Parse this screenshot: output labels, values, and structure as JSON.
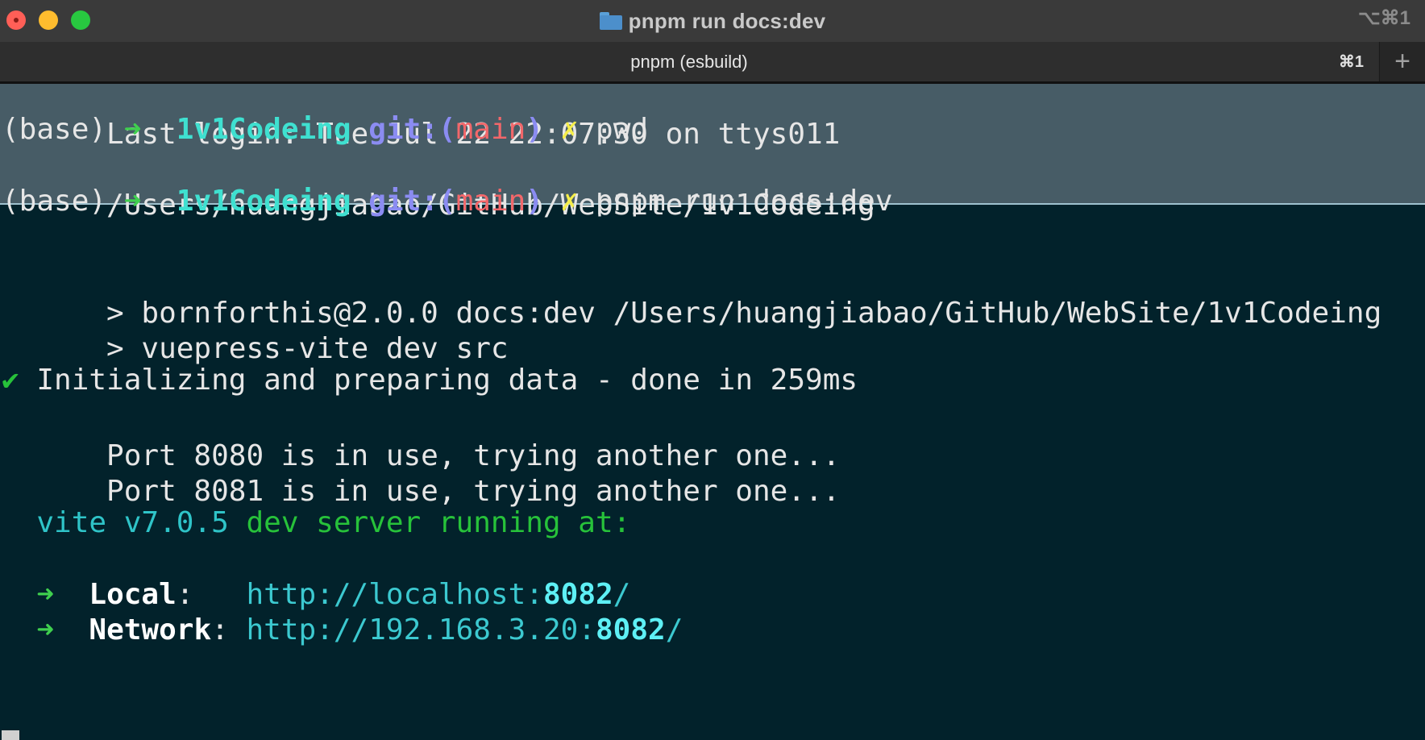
{
  "window": {
    "title": "pnpm run docs:dev",
    "title_shortcut": "⌥⌘1",
    "folder_icon": "folder-icon"
  },
  "tabbar": {
    "active_tab_label": "pnpm (esbuild)",
    "tab_shortcut": "⌘1",
    "new_tab_glyph": "+"
  },
  "terminal": {
    "last_login": "Last login: Tue Jul 22 22:07:30 on ttys011",
    "prompt": {
      "env": "(base)",
      "arrow": "➜",
      "dir": "1v1Codeing",
      "git_prefix": "git:(",
      "branch": "main",
      "git_suffix": ")",
      "dirty": "✗"
    },
    "cmd1": "pwd",
    "pwd_output": "/Users/huangjiabao/GitHub/WebSite/1v1Codeing",
    "cmd2": "pnpm run docs:dev",
    "script_line1": "> bornforthis@2.0.0 docs:dev /Users/huangjiabao/GitHub/WebSite/1v1Codeing",
    "script_line2": "> vuepress-vite dev src",
    "check_mark": "✔",
    "init_line": "Initializing and preparing data - done in 259ms",
    "port_line1": "Port 8080 is in use, trying another one...",
    "port_line2": "Port 8081 is in use, trying another one...",
    "vite_version": "vite v7.0.5",
    "vite_running": "dev server running at:",
    "local_label": "Local",
    "local_url_prefix": "http://localhost:",
    "local_port": "8082",
    "local_url_suffix": "/",
    "network_label": "Network",
    "network_url_prefix": "http://192.168.3.20:",
    "network_port": "8082",
    "network_url_suffix": "/",
    "colon": ":"
  },
  "colors": {
    "terminal_bg": "#02222b",
    "selection_bg": "#475c66",
    "prompt_arrow": "#3fcf4e",
    "dir": "#3fe0d0",
    "git": "#8b8cf2",
    "branch": "#f2676a",
    "dirty": "#f5ee4a"
  }
}
